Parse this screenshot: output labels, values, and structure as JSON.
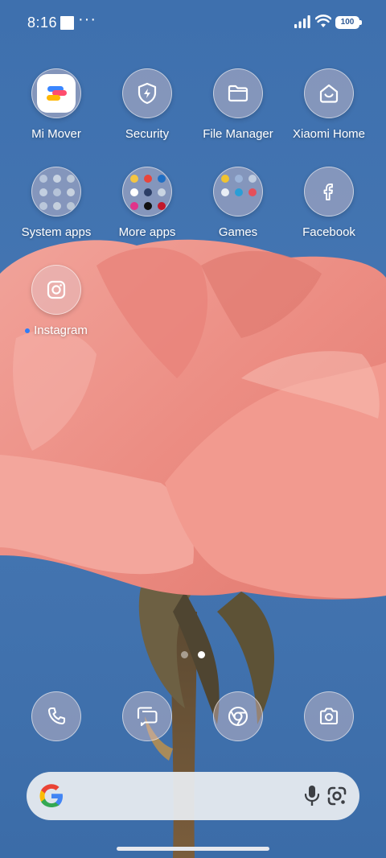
{
  "status_bar": {
    "time": "8:16",
    "more": "···",
    "battery": "100",
    "icons": [
      "notification-square-icon",
      "signal-icon",
      "wifi-icon",
      "battery-icon"
    ]
  },
  "home": {
    "apps": [
      {
        "label": "Mi Mover",
        "icon": "mi-mover-icon"
      },
      {
        "label": "Security",
        "icon": "shield-bolt-icon"
      },
      {
        "label": "File Manager",
        "icon": "folder-icon"
      },
      {
        "label": "Xiaomi Home",
        "icon": "smart-home-icon"
      },
      {
        "label": "System apps",
        "icon": "folder-preview-icon"
      },
      {
        "label": "More apps",
        "icon": "folder-preview-icon"
      },
      {
        "label": "Games",
        "icon": "folder-preview-icon"
      },
      {
        "label": "Facebook",
        "icon": "facebook-icon"
      },
      {
        "label": "Instagram",
        "icon": "instagram-icon",
        "new_indicator": true
      }
    ]
  },
  "page_indicator": {
    "total": 2,
    "current": 2
  },
  "dock": [
    {
      "name": "phone",
      "icon": "phone-icon"
    },
    {
      "name": "messages",
      "icon": "messages-icon"
    },
    {
      "name": "chrome",
      "icon": "chrome-icon"
    },
    {
      "name": "camera",
      "icon": "camera-icon"
    }
  ],
  "search_bar": {
    "icons": [
      "google-logo-icon",
      "mic-icon",
      "google-lens-icon"
    ]
  },
  "colors": {
    "sky": "#3f72b0",
    "petal": "#ec8c82",
    "accent_dot": "#2f7df6"
  }
}
